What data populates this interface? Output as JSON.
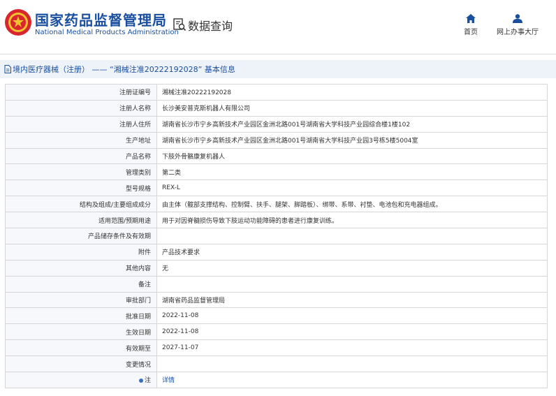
{
  "header": {
    "brand_cn": "国家药品监督管理局",
    "brand_en": "National Medical Products Administration",
    "query_label": "数据查询",
    "nav": [
      {
        "label": "首页",
        "icon": "home-icon"
      },
      {
        "label": "网上办事大厅",
        "icon": "user-icon"
      }
    ]
  },
  "breadcrumb": {
    "text": "境内医疗器械（注册） —— “湘械注准20222192028” 基本信息"
  },
  "rows": [
    {
      "label": "注册证编号",
      "value": "湘械注准20222192028"
    },
    {
      "label": "注册人名称",
      "value": "长沙美安普克斯机器人有限公司"
    },
    {
      "label": "注册人住所",
      "value": "湖南省长沙市宁乡高新技术产业园区金洲北路001号湖南省大学科技产业园综合楼1楼102"
    },
    {
      "label": "生产地址",
      "value": "湖南省长沙市宁乡高新技术产业园区金洲北路001号湖南省大学科技产业园3号栋5楼5004室"
    },
    {
      "label": "产品名称",
      "value": "下肢外骨骼康复机器人"
    },
    {
      "label": "管理类别",
      "value": "第二类"
    },
    {
      "label": "型号规格",
      "value": "REX-L"
    },
    {
      "label": "结构及组成/主要组成成分",
      "value": "由主体（髋部支撑结构、控制臂、扶手、腿架、脚踏板）、绑带、系带、衬垫、电池包和充电器组成。"
    },
    {
      "label": "适用范围/预期用途",
      "value": "用于对因脊髓损伤导致下肢运动功能障碍的患者进行康复训练。"
    },
    {
      "label": "产品储存条件及有效期",
      "value": ""
    },
    {
      "label": "附件",
      "value": "产品技术要求"
    },
    {
      "label": "其他内容",
      "value": "无"
    },
    {
      "label": "备注",
      "value": ""
    },
    {
      "label": "审批部门",
      "value": "湖南省药品监督管理局"
    },
    {
      "label": "批准日期",
      "value": "2022-11-08"
    },
    {
      "label": "生效日期",
      "value": "2022-11-08"
    },
    {
      "label": "有效期至",
      "value": "2027-11-07"
    },
    {
      "label": "变更情况",
      "value": ""
    }
  ],
  "note_row": {
    "label": "注",
    "value": "详情"
  },
  "colors": {
    "brand": "#1a4fa0",
    "label_bg": "#f6f8fb",
    "crumb_bg": "#eef3fa"
  }
}
